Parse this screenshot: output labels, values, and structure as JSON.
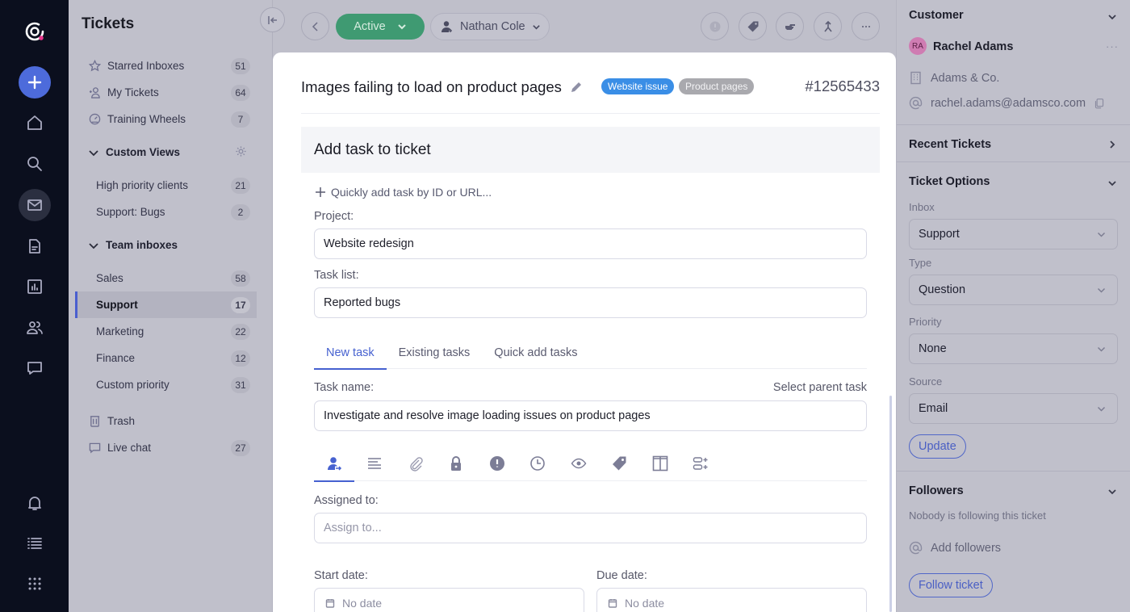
{
  "rail": {
    "items": [
      "logo",
      "new",
      "home",
      "search",
      "inbox",
      "documents",
      "reports",
      "customers",
      "chat",
      "notifications",
      "tasks",
      "apps"
    ]
  },
  "sidebar": {
    "title": "Tickets",
    "items": [
      {
        "label": "Starred Inboxes",
        "count": "51",
        "icon": "star-icon"
      },
      {
        "label": "My Tickets",
        "count": "64",
        "icon": "user-plus-icon"
      },
      {
        "label": "Training Wheels",
        "count": "7",
        "icon": "gauge-icon"
      }
    ],
    "custom_views": {
      "label": "Custom Views",
      "items": [
        {
          "label": "High priority clients",
          "count": "21"
        },
        {
          "label": "Support: Bugs",
          "count": "2"
        }
      ]
    },
    "team_inboxes": {
      "label": "Team inboxes",
      "items": [
        {
          "label": "Sales",
          "count": "58"
        },
        {
          "label": "Support",
          "count": "17",
          "selected": true
        },
        {
          "label": "Marketing",
          "count": "22"
        },
        {
          "label": "Finance",
          "count": "12"
        },
        {
          "label": "Custom priority",
          "count": "31"
        }
      ]
    },
    "bottom": [
      {
        "label": "Trash",
        "count": "",
        "icon": "trash-icon"
      },
      {
        "label": "Live chat",
        "count": "27",
        "icon": "chat-icon"
      }
    ]
  },
  "toolbar": {
    "status": "Active",
    "assignee": "Nathan Cole"
  },
  "ticket": {
    "title": "Images failing to load on product pages",
    "tags": [
      "Website issue",
      "Product pages"
    ],
    "id": "#12565433"
  },
  "task_form": {
    "heading": "Add task to ticket",
    "quick_add": "Quickly add task by ID or URL...",
    "project_label": "Project:",
    "project_value": "Website redesign",
    "tasklist_label": "Task list:",
    "tasklist_value": "Reported bugs",
    "tabs": [
      "New task",
      "Existing tasks",
      "Quick add tasks"
    ],
    "active_tab": "New task",
    "task_name_label": "Task name:",
    "select_parent": "Select parent task",
    "task_name_value": "Investigate and resolve image loading issues on product pages",
    "icon_tabs": [
      "assignee",
      "description",
      "attachments",
      "privacy",
      "priority",
      "time",
      "followers",
      "tags",
      "board-column",
      "subtasks"
    ],
    "assigned_label": "Assigned to:",
    "assigned_placeholder": "Assign to...",
    "start_label": "Start date:",
    "start_value": "No date",
    "due_label": "Due date:",
    "due_value": "No date"
  },
  "right_panel": {
    "customer": {
      "heading": "Customer",
      "initials": "RA",
      "name": "Rachel Adams",
      "company": "Adams & Co.",
      "email": "rachel.adams@adamsco.com"
    },
    "recent_tickets": "Recent Tickets",
    "ticket_options": {
      "heading": "Ticket Options",
      "inbox_label": "Inbox",
      "inbox_value": "Support",
      "type_label": "Type",
      "type_value": "Question",
      "priority_label": "Priority",
      "priority_value": "None",
      "source_label": "Source",
      "source_value": "Email",
      "update_button": "Update"
    },
    "followers": {
      "heading": "Followers",
      "empty_text": "Nobody is following this ticket",
      "add_label": "Add followers",
      "follow_button": "Follow ticket"
    }
  },
  "colors": {
    "accent": "#4661d0",
    "status_active": "#3f9a72",
    "tag_blue": "#3a8ee6",
    "tag_gray": "#a9a9ae",
    "avatar": "#cf7cb2"
  }
}
